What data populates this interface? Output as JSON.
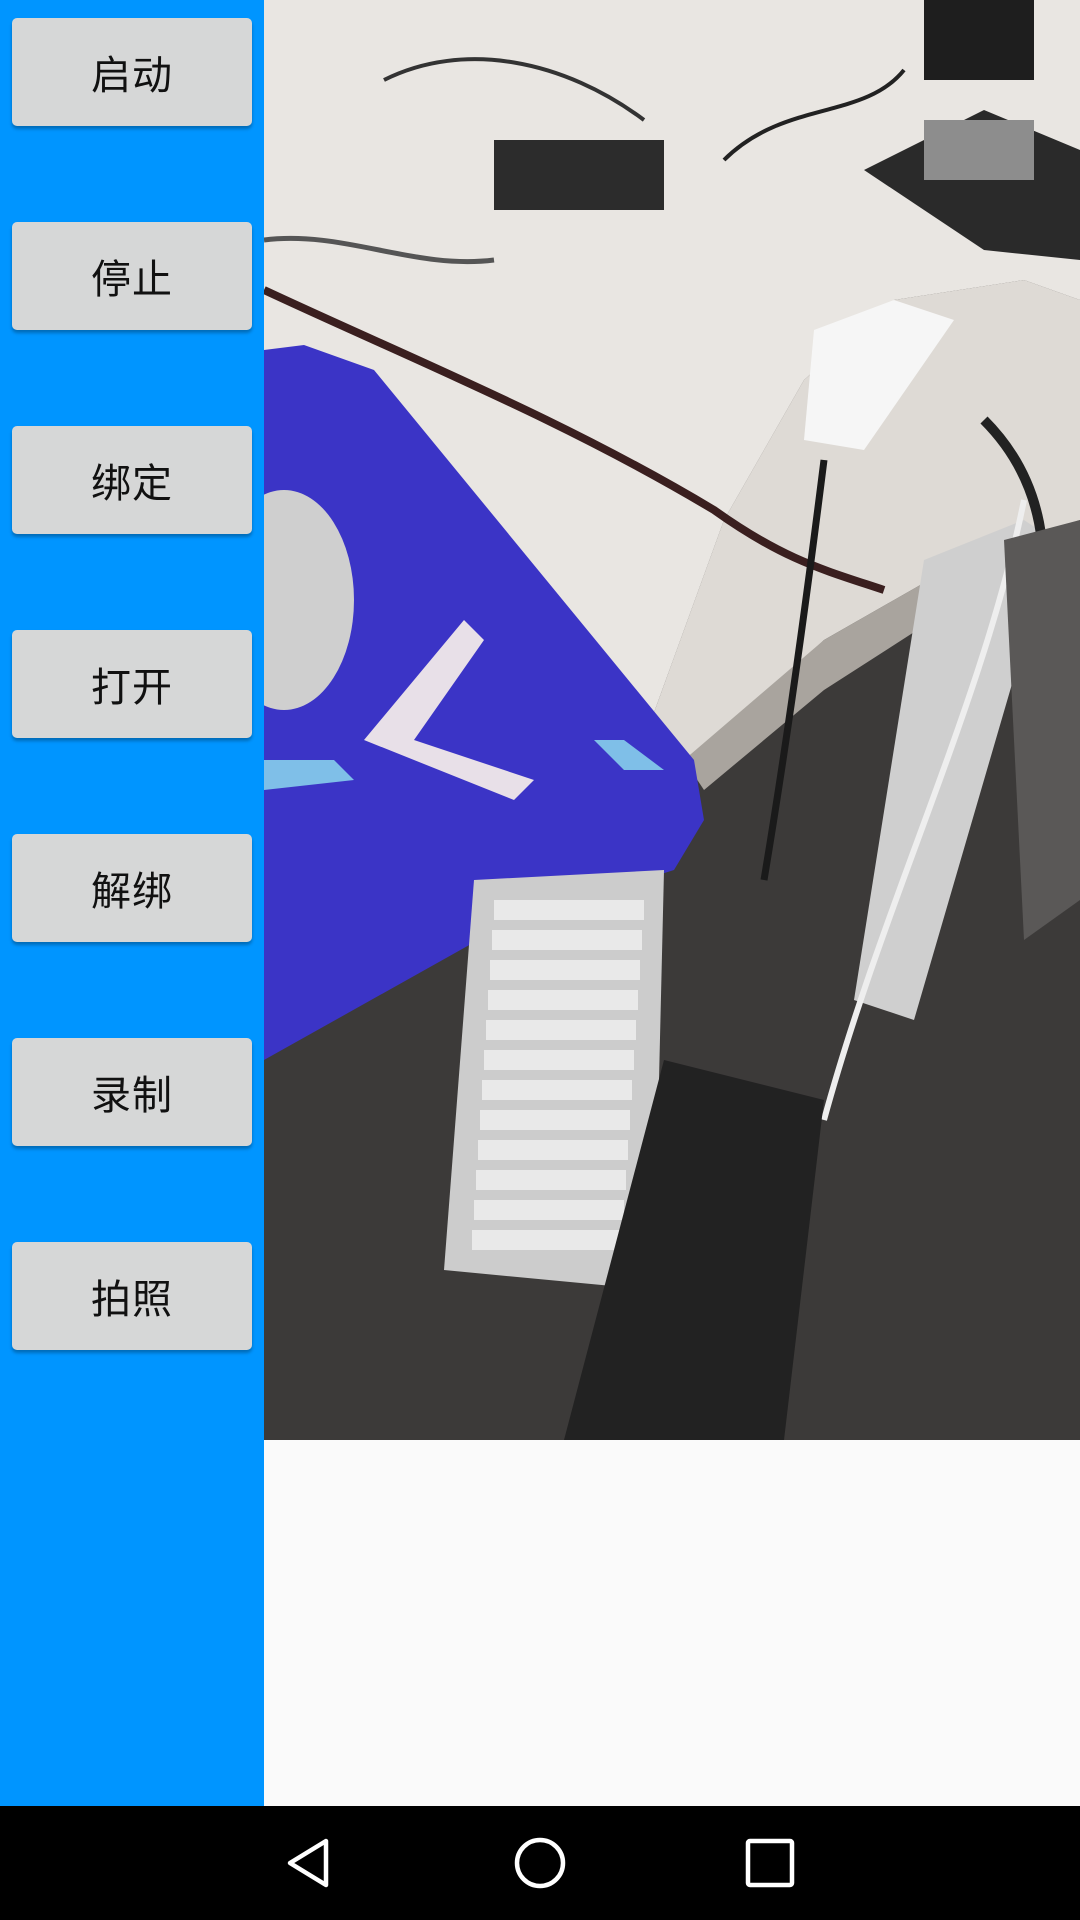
{
  "side_panel": {
    "color": "#0095ff",
    "buttons": [
      {
        "label": "启动"
      },
      {
        "label": "停止"
      },
      {
        "label": "绑定"
      },
      {
        "label": "打开"
      },
      {
        "label": "解绑"
      },
      {
        "label": "录制"
      },
      {
        "label": "拍照"
      }
    ]
  },
  "preview": {
    "content": "camera-preview"
  },
  "nav_bar": {
    "icons": [
      "back-icon",
      "home-icon",
      "recents-icon"
    ]
  }
}
